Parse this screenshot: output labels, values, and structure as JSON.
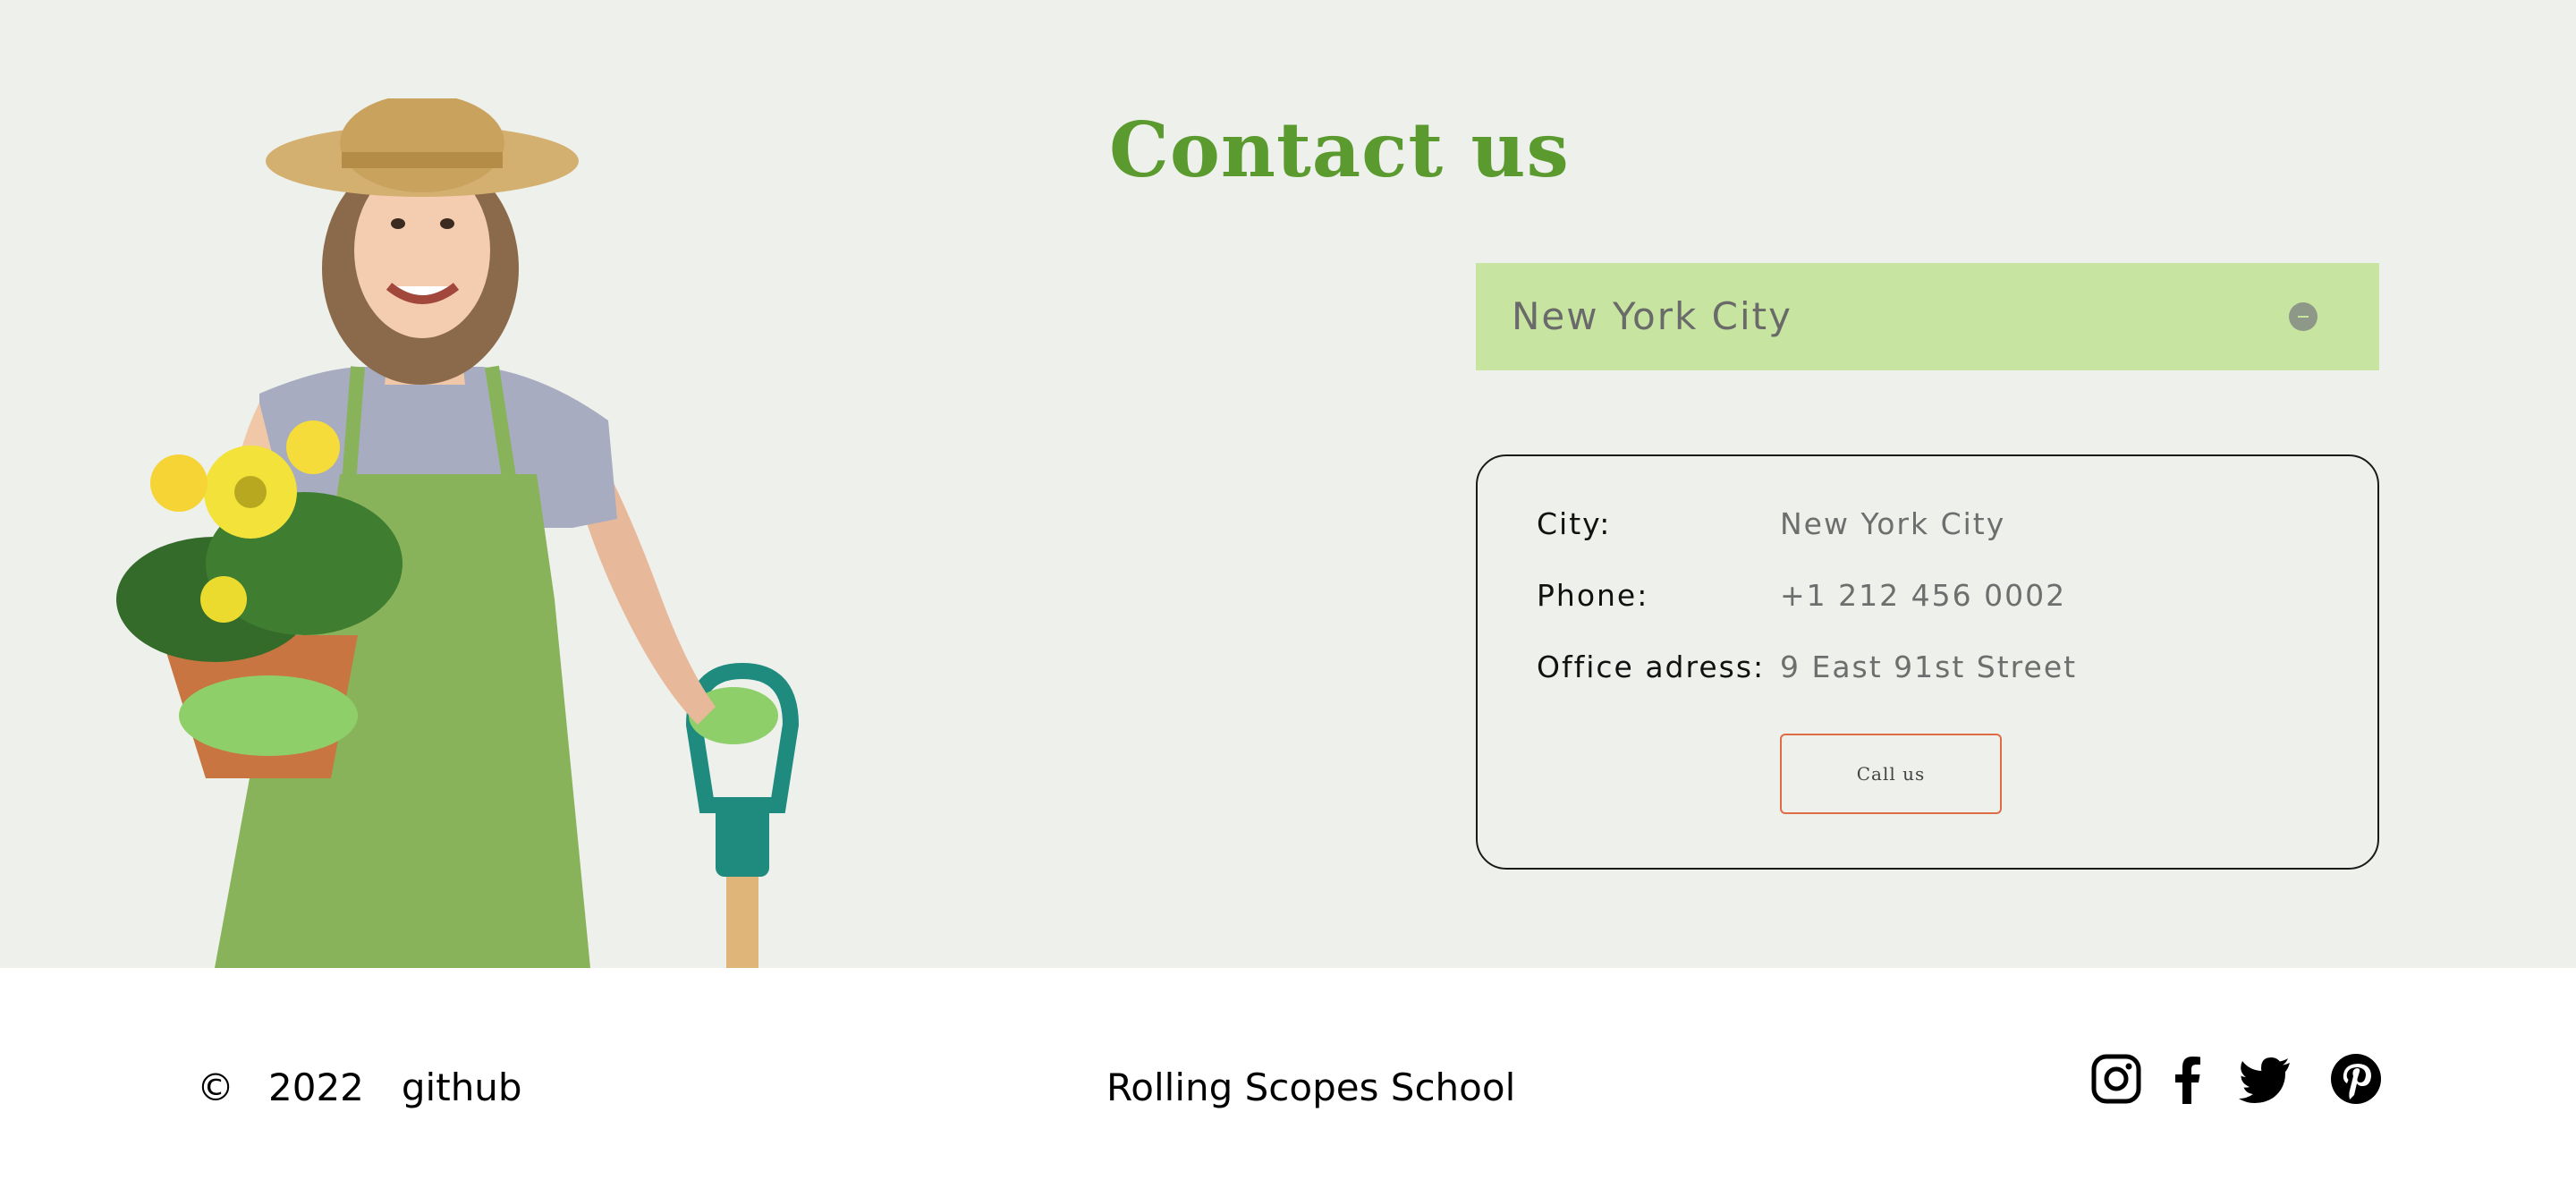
{
  "contact": {
    "title": "Contact us",
    "selected_city": "New York City",
    "card": {
      "rows": [
        {
          "label": "City:",
          "value": "New York City"
        },
        {
          "label": "Phone:",
          "value": "+1 212 456 0002"
        },
        {
          "label": "Office adress:",
          "value": "9 East 91st Street"
        }
      ],
      "call_button": "Call us"
    }
  },
  "footer": {
    "copyright_symbol": "©",
    "year": "2022",
    "github_link": "github",
    "school_link": "Rolling Scopes School",
    "social": [
      "instagram-icon",
      "facebook-icon",
      "twitter-icon",
      "pinterest-icon"
    ]
  },
  "colors": {
    "accent_green": "#5b9a2f",
    "select_bg": "#c7e5a0",
    "section_bg": "#eef0ec",
    "button_border": "#e06c46"
  }
}
